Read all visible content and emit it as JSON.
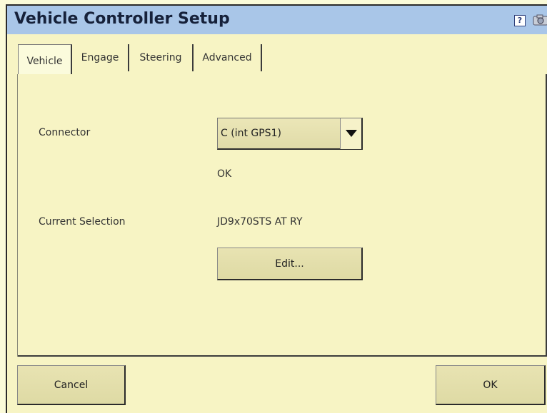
{
  "window": {
    "title": "Vehicle Controller Setup",
    "help_glyph": "?"
  },
  "tabs": [
    {
      "label": "Vehicle",
      "active": true
    },
    {
      "label": "Engage",
      "active": false
    },
    {
      "label": "Steering",
      "active": false
    },
    {
      "label": "Advanced",
      "active": false
    }
  ],
  "form": {
    "connector_label": "Connector",
    "connector_value": "C (int GPS1)",
    "connector_status": "OK",
    "current_selection_label": "Current Selection",
    "current_selection_value": "JD9x70STS AT RY",
    "edit_button": "Edit..."
  },
  "footer": {
    "cancel_button": "Cancel",
    "ok_button": "OK"
  },
  "colors": {
    "background": "#f7f4c4",
    "titlebar": "#a9c6e8",
    "button": "#e4dfad"
  },
  "icons": {
    "help": "help-icon",
    "snapshot": "camera-icon"
  }
}
